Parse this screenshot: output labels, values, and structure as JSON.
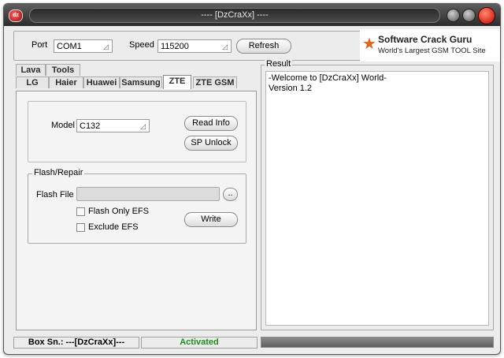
{
  "window": {
    "title": "---- [DzCraXx] ----"
  },
  "top": {
    "port_label": "Port",
    "port_value": "COM1",
    "speed_label": "Speed",
    "speed_value": "115200",
    "refresh_label": "Refresh"
  },
  "logo": {
    "title": "Software Crack Guru",
    "subtitle": "World's Largest GSM TOOL Site"
  },
  "tabs": {
    "row1": [
      "Lava",
      "Tools"
    ],
    "row2": [
      "LG",
      "Haier",
      "Huawei",
      "Samsung",
      "ZTE",
      "ZTE GSM"
    ],
    "active": "ZTE"
  },
  "model": {
    "label": "Model",
    "value": "C132",
    "read_info": "Read Info",
    "sp_unlock": "SP Unlock"
  },
  "flash": {
    "group_title": "Flash/Repair",
    "file_label": "Flash File",
    "file_value": "",
    "browse": "..",
    "flash_only_efs": "Flash Only EFS",
    "exclude_efs": "Exclude EFS",
    "write": "Write"
  },
  "result": {
    "title": "Result",
    "lines": [
      "-Welcome to [DzCraXx] World-",
      "Version 1.2"
    ]
  },
  "status": {
    "box_sn": "Box Sn.: ---[DzCraXx]---",
    "activation": "Activated",
    "activation_color": "#1a8f1a"
  }
}
